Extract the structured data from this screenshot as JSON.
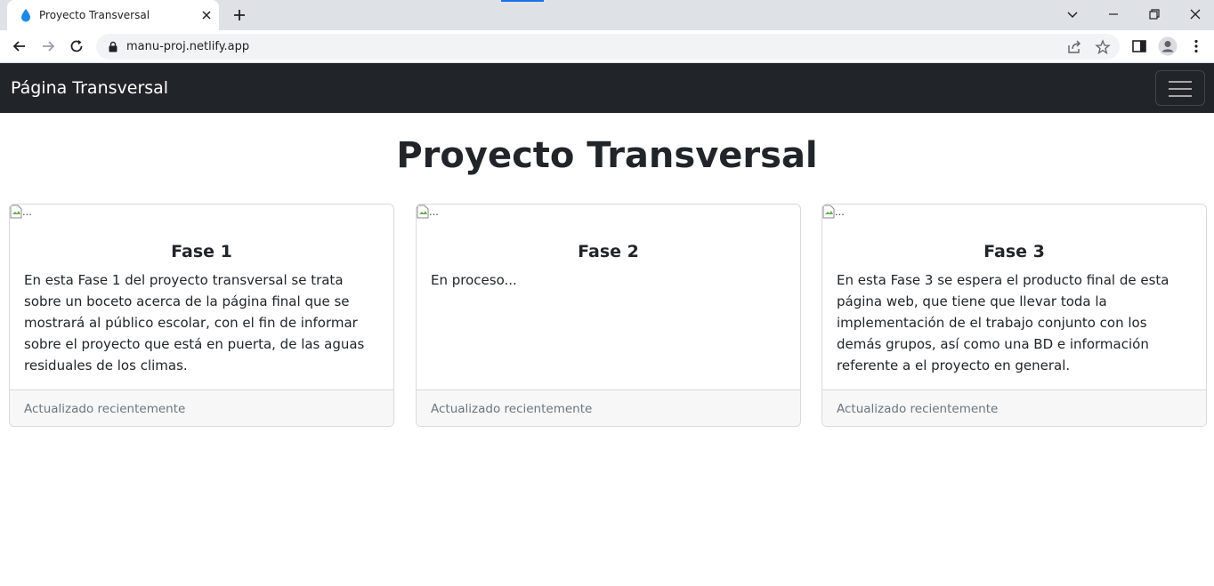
{
  "browser": {
    "tab_title": "Proyecto Transversal",
    "url": "manu-proj.netlify.app",
    "icons": {
      "favicon": "water-drop-icon",
      "tab_close": "close-icon",
      "new_tab": "plus-icon",
      "tab_search": "chevron-down-icon",
      "minimize": "minimize-icon",
      "restore": "restore-icon",
      "close_window": "close-icon",
      "back": "back-arrow-icon",
      "forward": "forward-arrow-icon",
      "reload": "reload-icon",
      "lock": "lock-icon",
      "share": "share-icon",
      "bookmark": "star-icon",
      "side_panel": "side-panel-icon",
      "profile": "profile-icon",
      "menu": "kebab-menu-icon"
    }
  },
  "navbar": {
    "brand": "Página Transversal",
    "toggler_icon": "hamburger-icon"
  },
  "main": {
    "title": "Proyecto Transversal",
    "cards": [
      {
        "img_alt": "...",
        "title": "Fase 1",
        "text": "En esta Fase 1 del proyecto transversal se trata sobre un boceto acerca de la página final que se mostrará al público escolar, con el fin de informar sobre el proyecto que está en puerta, de las aguas residuales de los climas.",
        "footer": "Actualizado recientemente"
      },
      {
        "img_alt": "...",
        "title": "Fase 2",
        "text": "En proceso...",
        "footer": "Actualizado recientemente"
      },
      {
        "img_alt": "...",
        "title": "Fase 3",
        "text": "En esta Fase 3 se espera el producto final de esta página web, que tiene que llevar toda la implementación de el trabajo conjunto con los demás grupos, así como una BD e información referente a el proyecto en general.",
        "footer": "Actualizado recientemente"
      }
    ]
  },
  "colors": {
    "navbar_bg": "#212529",
    "tabstrip_bg": "#dee1e6",
    "card_footer_bg": "#f7f7f7",
    "accent": "#1a73e8"
  }
}
